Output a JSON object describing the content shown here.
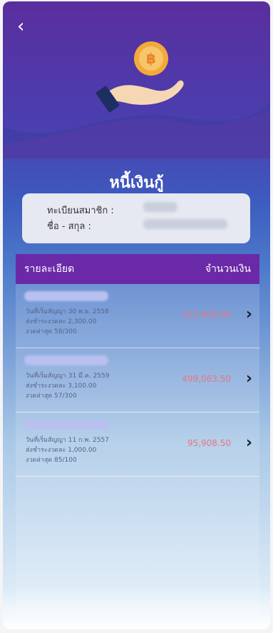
{
  "nav": {
    "back_icon": "chevron-left-icon",
    "back_glyph": "‹"
  },
  "header": {
    "title": "หนี้เงินกู้",
    "hero_icon": "hand-coin-icon",
    "coin_symbol": "฿"
  },
  "member": {
    "id_label": "ทะเบียนสมาชิก :",
    "name_label": "ชื่อ - สกุล :"
  },
  "table": {
    "col_detail": "รายละเอียด",
    "col_amount": "จำนวนเงิน"
  },
  "loans": [
    {
      "contract_date": "วันที่เริ่มสัญญา 30 พ.ย. 2558",
      "installment": "ส่งชำระงวดละ 2,300.00",
      "latest_period": "งวดล่าสุด 58/300",
      "amount": "525,900.00"
    },
    {
      "contract_date": "วันที่เริ่มสัญญา 31 มี.ค. 2559",
      "installment": "ส่งชำระงวดละ 3,100.00",
      "latest_period": "งวดล่าสุด 57/300",
      "amount": "499,063.50"
    },
    {
      "contract_date": "วันที่เริ่มสัญญา 11 ก.พ. 2557",
      "installment": "ส่งชำระงวดละ 1,000.00",
      "latest_period": "งวดล่าสุด 85/100",
      "amount": "95,908.50"
    }
  ],
  "colors": {
    "header_purple": "#6a2aa8",
    "amount_red": "#e87585",
    "coin_gold": "#f3a93b"
  }
}
